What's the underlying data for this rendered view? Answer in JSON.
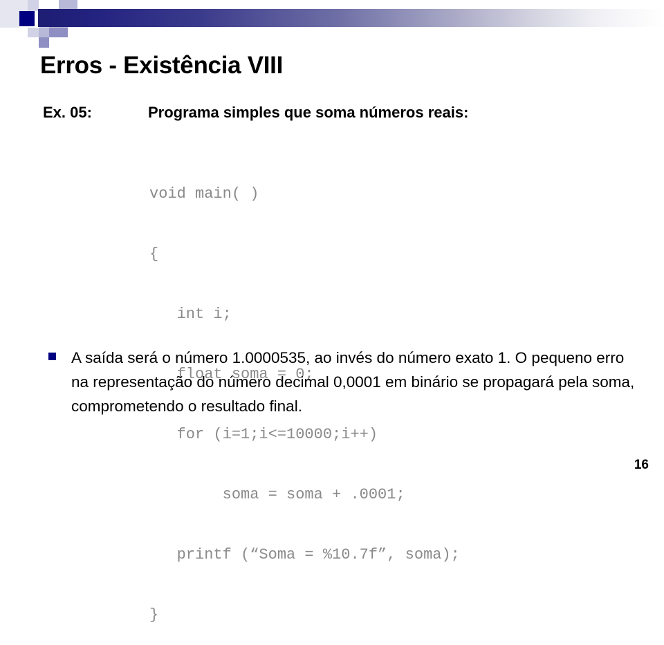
{
  "slide": {
    "title": "Erros - Existência VIII",
    "page_number": "16",
    "accent_color": "#000080",
    "header_gradient_from": "#1d1d73",
    "header_gradient_to": "#ffffff"
  },
  "example": {
    "label": "Ex. 05:",
    "description": "Programa simples que soma números reais:"
  },
  "code": {
    "language": "c",
    "color": "#8a8a8a",
    "lines": [
      "void main( )",
      "{",
      "   int i;",
      "   float soma = 0;",
      "   for (i=1;i<=10000;i++)",
      "        soma = soma + .0001;",
      "   printf (“Soma = %10.7f”, soma);",
      "}"
    ]
  },
  "bullets": [
    {
      "marker": "square-bullet",
      "text": "A saída será o número 1.0000535, ao invés do número exato 1. O pequeno erro na representação do número decimal 0,0001 em binário se propagará pela soma, comprometendo o resultado final."
    }
  ]
}
